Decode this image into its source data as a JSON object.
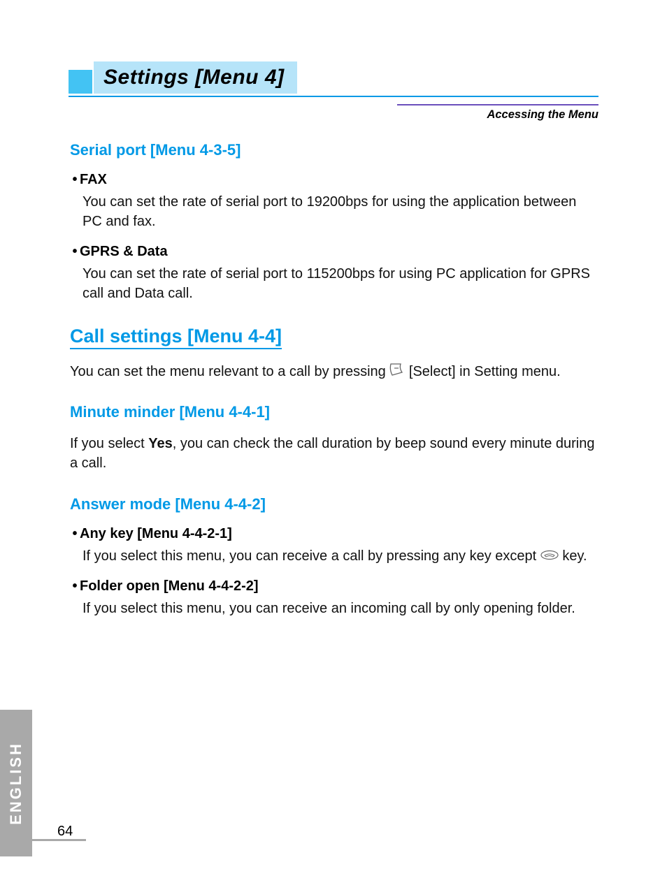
{
  "header": {
    "title": "Settings [Menu 4]",
    "breadcrumb": "Accessing the Menu"
  },
  "sections": {
    "serial_port": {
      "heading": "Serial port [Menu 4-3-5]",
      "fax": {
        "title": "FAX",
        "body": "You can set the rate of serial port to 19200bps for using the application between PC and fax."
      },
      "gprs": {
        "title": "GPRS & Data",
        "body": "You can set the rate of serial port to 115200bps for using PC application for GPRS call and Data call."
      }
    },
    "call_settings": {
      "heading": "Call settings [Menu 4-4]",
      "intro_before": "You can set the menu relevant to a call by pressing ",
      "intro_after": "[Select] in Setting menu."
    },
    "minute_minder": {
      "heading": "Minute minder [Menu 4-4-1]",
      "body_before": "If you select ",
      "body_bold": "Yes",
      "body_after": ", you can check the call duration by beep sound every minute during a call."
    },
    "answer_mode": {
      "heading": "Answer mode [Menu 4-4-2]",
      "any_key": {
        "title": "Any key [Menu 4-4-2-1]",
        "body_before": "If you select this menu, you can receive a call by pressing any key except ",
        "body_after": " key."
      },
      "folder_open": {
        "title": "Folder open [Menu 4-4-2-2]",
        "body": "If you select this menu, you can receive an incoming call by only opening folder."
      }
    }
  },
  "side_label": "ENGLISH",
  "page_number": "64"
}
